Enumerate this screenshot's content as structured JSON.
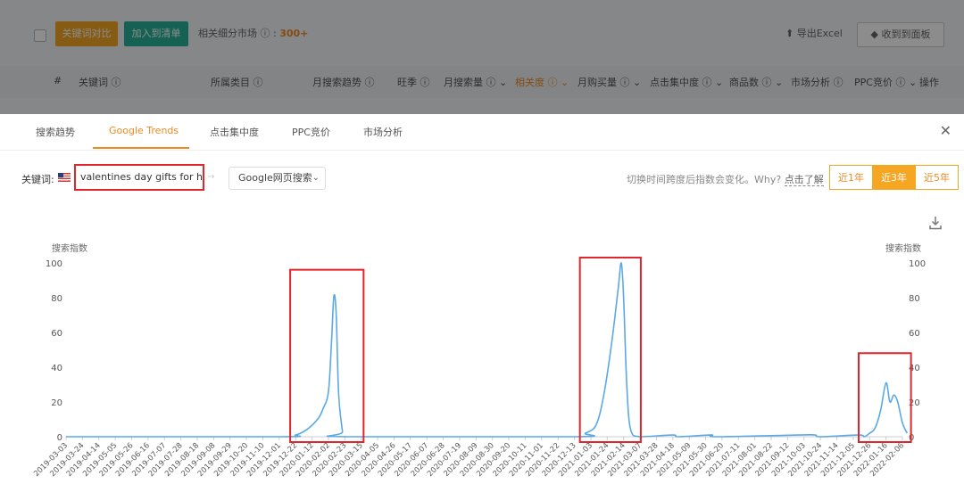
{
  "background": {
    "btn_primary": "关键词对比",
    "btn_add": "加入到清单",
    "market_label": "相关细分市场 ⓘ :",
    "market_count": "300+",
    "export": "导出Excel",
    "collect": "收到到面板",
    "columns": [
      "#",
      "关键词 ⓘ",
      "所属类目 ⓘ",
      "月搜索趋势 ⓘ",
      "旺季 ⓘ",
      "月搜索量 ⓘ ⌄",
      "相关度 ⓘ ⌄",
      "月购买量 ⓘ ⌄",
      "点击集中度 ⓘ ⌄",
      "商品数 ⓘ ⌄",
      "市场分析 ⓘ",
      "PPC竞价 ⓘ ⌄",
      "操作"
    ]
  },
  "tabs": [
    "搜索趋势",
    "Google Trends",
    "点击集中度",
    "PPC竞价",
    "市场分析"
  ],
  "active_tab": 1,
  "keyword_label": "关键词:",
  "keyword_value": "valentines day gifts for her",
  "search_type": "Google网页搜索",
  "hint_text": "切换时间跨度后指数会变化。Why?",
  "hint_link": "点击了解",
  "ranges": [
    "近1年",
    "近3年",
    "近5年"
  ],
  "active_range": 1,
  "accent_color": "#f08a24",
  "chart_data": {
    "type": "line",
    "ylabel_left": "搜索指数",
    "ylabel_right": "搜索指数",
    "ylim": [
      0,
      100
    ],
    "yticks": [
      0,
      20,
      40,
      60,
      80,
      100
    ],
    "xticks": [
      "2019-03-03",
      "2019-03-24",
      "2019-04-14",
      "2019-05-05",
      "2019-05-26",
      "2019-06-16",
      "2019-07-07",
      "2019-07-28",
      "2019-08-18",
      "2019-09-08",
      "2019-09-29",
      "2019-10-20",
      "2019-11-10",
      "2019-12-01",
      "2019-12-22",
      "2020-01-12",
      "2020-02-02",
      "2020-02-23",
      "2020-03-15",
      "2020-04-05",
      "2020-04-26",
      "2020-05-17",
      "2020-06-07",
      "2020-06-28",
      "2020-07-19",
      "2020-08-09",
      "2020-08-30",
      "2020-09-20",
      "2020-10-11",
      "2020-11-01",
      "2020-11-22",
      "2020-12-13",
      "2021-01-03",
      "2021-01-24",
      "2021-02-14",
      "2021-03-07",
      "2021-03-28",
      "2021-04-18",
      "2021-05-09",
      "2021-05-30",
      "2021-06-20",
      "2021-07-11",
      "2021-08-01",
      "2021-08-22",
      "2021-09-12",
      "2021-10-03",
      "2021-10-24",
      "2021-11-14",
      "2021-12-05",
      "2021-12-26",
      "2022-01-16",
      "2022-02-06"
    ],
    "series": [
      {
        "color": "#5aa9e6",
        "points": [
          [
            "2019-03-03",
            0
          ],
          [
            "2019-12-01",
            0
          ],
          [
            "2019-12-22",
            1
          ],
          [
            "2020-01-05",
            4
          ],
          [
            "2020-01-19",
            10
          ],
          [
            "2020-01-26",
            16
          ],
          [
            "2020-02-02",
            26
          ],
          [
            "2020-02-06",
            55
          ],
          [
            "2020-02-09",
            81
          ],
          [
            "2020-02-12",
            70
          ],
          [
            "2020-02-15",
            25
          ],
          [
            "2020-02-20",
            3
          ],
          [
            "2020-02-23",
            0
          ],
          [
            "2020-12-13",
            0
          ],
          [
            "2020-12-27",
            2
          ],
          [
            "2021-01-10",
            7
          ],
          [
            "2021-01-20",
            25
          ],
          [
            "2021-01-30",
            55
          ],
          [
            "2021-02-07",
            85
          ],
          [
            "2021-02-11",
            100
          ],
          [
            "2021-02-14",
            80
          ],
          [
            "2021-02-18",
            30
          ],
          [
            "2021-02-23",
            4
          ],
          [
            "2021-03-07",
            0
          ],
          [
            "2021-04-18",
            1
          ],
          [
            "2021-04-25",
            0
          ],
          [
            "2021-06-06",
            1
          ],
          [
            "2021-06-13",
            0
          ],
          [
            "2021-09-26",
            1
          ],
          [
            "2021-10-17",
            1
          ],
          [
            "2021-10-24",
            0
          ],
          [
            "2021-12-12",
            1
          ],
          [
            "2021-12-19",
            0
          ],
          [
            "2021-12-26",
            2
          ],
          [
            "2022-01-02",
            5
          ],
          [
            "2022-01-09",
            15
          ],
          [
            "2022-01-16",
            31
          ],
          [
            "2022-01-21",
            20
          ],
          [
            "2022-01-26",
            24
          ],
          [
            "2022-01-31",
            20
          ],
          [
            "2022-02-06",
            8
          ],
          [
            "2022-02-12",
            2
          ]
        ]
      }
    ],
    "highlight_boxes": [
      {
        "x": [
          "2019-12-15",
          "2020-03-18"
        ],
        "y": [
          0,
          93
        ]
      },
      {
        "x": [
          "2020-12-20",
          "2021-03-08"
        ],
        "y": [
          0,
          100
        ]
      },
      {
        "x": [
          "2021-12-12",
          "2022-02-17"
        ],
        "y": [
          0,
          45
        ]
      }
    ]
  }
}
